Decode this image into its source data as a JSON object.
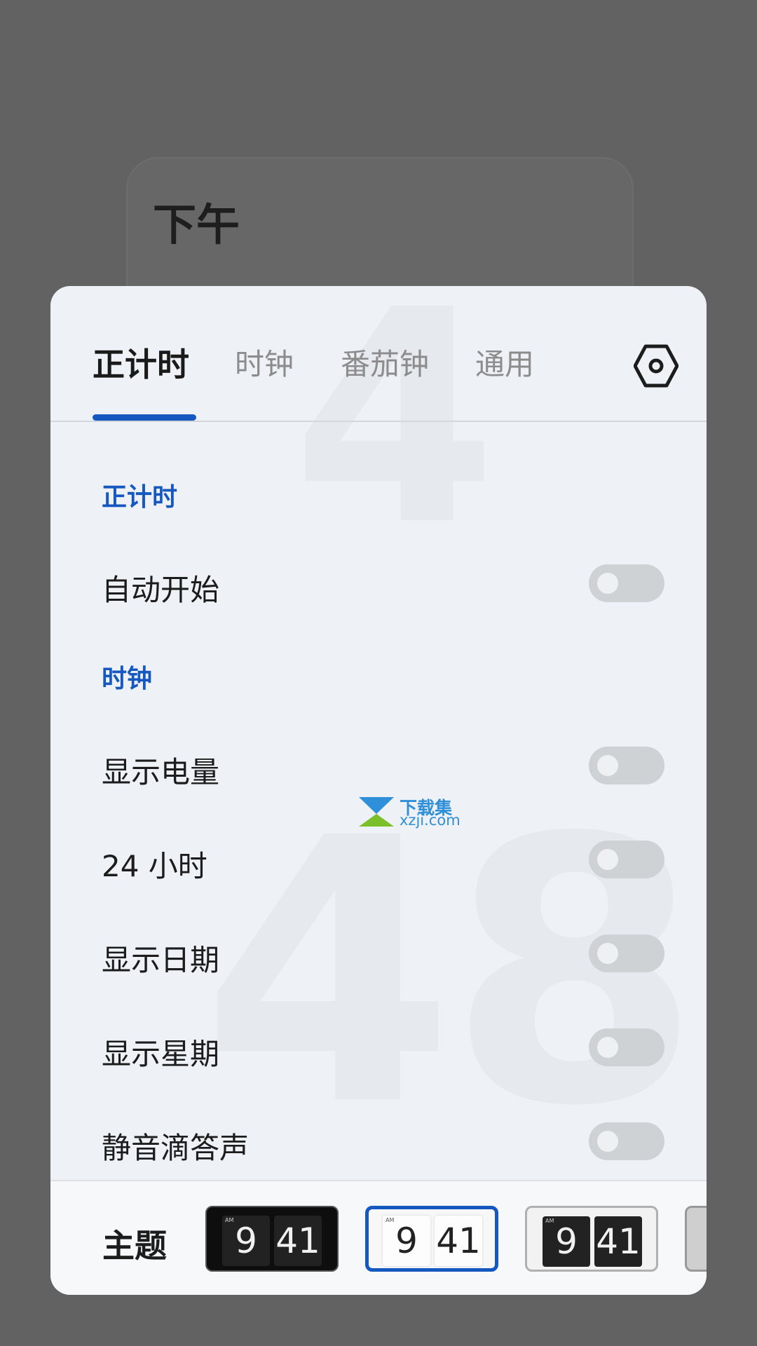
{
  "background": {
    "ampm_label": "下午"
  },
  "tabs": [
    {
      "label": "正计时",
      "active": true
    },
    {
      "label": "时钟",
      "active": false
    },
    {
      "label": "番茄钟",
      "active": false
    },
    {
      "label": "通用",
      "active": false
    }
  ],
  "settings_icon": "gear-icon",
  "sections": {
    "stopwatch": {
      "title": "正计时",
      "items": [
        {
          "label": "自动开始",
          "enabled": false
        }
      ]
    },
    "clock": {
      "title": "时钟",
      "items": [
        {
          "label": "显示电量",
          "enabled": false
        },
        {
          "label": "24 小时",
          "enabled": false
        },
        {
          "label": "显示日期",
          "enabled": false
        },
        {
          "label": "显示星期",
          "enabled": false
        },
        {
          "label": "静音滴答声",
          "enabled": false
        }
      ]
    }
  },
  "ghost_digits": {
    "top": "4",
    "bottom": "48"
  },
  "watermark": {
    "line1": "下载集",
    "line2": "xzji.com"
  },
  "theme": {
    "label": "主题",
    "options": [
      {
        "ampm": "AM",
        "hour": "9",
        "minute": "41",
        "style": "dark",
        "selected": false
      },
      {
        "ampm": "AM",
        "hour": "9",
        "minute": "41",
        "style": "light",
        "selected": true
      },
      {
        "ampm": "AM",
        "hour": "9",
        "minute": "41",
        "style": "contrast",
        "selected": false
      }
    ]
  },
  "colors": {
    "accent": "#1558c0",
    "overlay": "#626262",
    "sheet": "#eef1f5",
    "toggle_off": "#cfd2d5"
  }
}
